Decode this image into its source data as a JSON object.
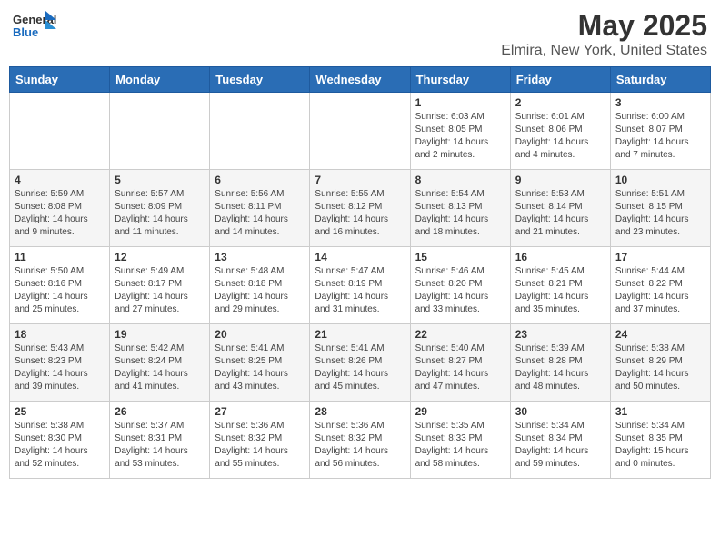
{
  "header": {
    "logo_general": "General",
    "logo_blue": "Blue",
    "title": "May 2025",
    "subtitle": "Elmira, New York, United States"
  },
  "days_of_week": [
    "Sunday",
    "Monday",
    "Tuesday",
    "Wednesday",
    "Thursday",
    "Friday",
    "Saturday"
  ],
  "weeks": [
    [
      {
        "day": "",
        "info": ""
      },
      {
        "day": "",
        "info": ""
      },
      {
        "day": "",
        "info": ""
      },
      {
        "day": "",
        "info": ""
      },
      {
        "day": "1",
        "info": "Sunrise: 6:03 AM\nSunset: 8:05 PM\nDaylight: 14 hours\nand 2 minutes."
      },
      {
        "day": "2",
        "info": "Sunrise: 6:01 AM\nSunset: 8:06 PM\nDaylight: 14 hours\nand 4 minutes."
      },
      {
        "day": "3",
        "info": "Sunrise: 6:00 AM\nSunset: 8:07 PM\nDaylight: 14 hours\nand 7 minutes."
      }
    ],
    [
      {
        "day": "4",
        "info": "Sunrise: 5:59 AM\nSunset: 8:08 PM\nDaylight: 14 hours\nand 9 minutes."
      },
      {
        "day": "5",
        "info": "Sunrise: 5:57 AM\nSunset: 8:09 PM\nDaylight: 14 hours\nand 11 minutes."
      },
      {
        "day": "6",
        "info": "Sunrise: 5:56 AM\nSunset: 8:11 PM\nDaylight: 14 hours\nand 14 minutes."
      },
      {
        "day": "7",
        "info": "Sunrise: 5:55 AM\nSunset: 8:12 PM\nDaylight: 14 hours\nand 16 minutes."
      },
      {
        "day": "8",
        "info": "Sunrise: 5:54 AM\nSunset: 8:13 PM\nDaylight: 14 hours\nand 18 minutes."
      },
      {
        "day": "9",
        "info": "Sunrise: 5:53 AM\nSunset: 8:14 PM\nDaylight: 14 hours\nand 21 minutes."
      },
      {
        "day": "10",
        "info": "Sunrise: 5:51 AM\nSunset: 8:15 PM\nDaylight: 14 hours\nand 23 minutes."
      }
    ],
    [
      {
        "day": "11",
        "info": "Sunrise: 5:50 AM\nSunset: 8:16 PM\nDaylight: 14 hours\nand 25 minutes."
      },
      {
        "day": "12",
        "info": "Sunrise: 5:49 AM\nSunset: 8:17 PM\nDaylight: 14 hours\nand 27 minutes."
      },
      {
        "day": "13",
        "info": "Sunrise: 5:48 AM\nSunset: 8:18 PM\nDaylight: 14 hours\nand 29 minutes."
      },
      {
        "day": "14",
        "info": "Sunrise: 5:47 AM\nSunset: 8:19 PM\nDaylight: 14 hours\nand 31 minutes."
      },
      {
        "day": "15",
        "info": "Sunrise: 5:46 AM\nSunset: 8:20 PM\nDaylight: 14 hours\nand 33 minutes."
      },
      {
        "day": "16",
        "info": "Sunrise: 5:45 AM\nSunset: 8:21 PM\nDaylight: 14 hours\nand 35 minutes."
      },
      {
        "day": "17",
        "info": "Sunrise: 5:44 AM\nSunset: 8:22 PM\nDaylight: 14 hours\nand 37 minutes."
      }
    ],
    [
      {
        "day": "18",
        "info": "Sunrise: 5:43 AM\nSunset: 8:23 PM\nDaylight: 14 hours\nand 39 minutes."
      },
      {
        "day": "19",
        "info": "Sunrise: 5:42 AM\nSunset: 8:24 PM\nDaylight: 14 hours\nand 41 minutes."
      },
      {
        "day": "20",
        "info": "Sunrise: 5:41 AM\nSunset: 8:25 PM\nDaylight: 14 hours\nand 43 minutes."
      },
      {
        "day": "21",
        "info": "Sunrise: 5:41 AM\nSunset: 8:26 PM\nDaylight: 14 hours\nand 45 minutes."
      },
      {
        "day": "22",
        "info": "Sunrise: 5:40 AM\nSunset: 8:27 PM\nDaylight: 14 hours\nand 47 minutes."
      },
      {
        "day": "23",
        "info": "Sunrise: 5:39 AM\nSunset: 8:28 PM\nDaylight: 14 hours\nand 48 minutes."
      },
      {
        "day": "24",
        "info": "Sunrise: 5:38 AM\nSunset: 8:29 PM\nDaylight: 14 hours\nand 50 minutes."
      }
    ],
    [
      {
        "day": "25",
        "info": "Sunrise: 5:38 AM\nSunset: 8:30 PM\nDaylight: 14 hours\nand 52 minutes."
      },
      {
        "day": "26",
        "info": "Sunrise: 5:37 AM\nSunset: 8:31 PM\nDaylight: 14 hours\nand 53 minutes."
      },
      {
        "day": "27",
        "info": "Sunrise: 5:36 AM\nSunset: 8:32 PM\nDaylight: 14 hours\nand 55 minutes."
      },
      {
        "day": "28",
        "info": "Sunrise: 5:36 AM\nSunset: 8:32 PM\nDaylight: 14 hours\nand 56 minutes."
      },
      {
        "day": "29",
        "info": "Sunrise: 5:35 AM\nSunset: 8:33 PM\nDaylight: 14 hours\nand 58 minutes."
      },
      {
        "day": "30",
        "info": "Sunrise: 5:34 AM\nSunset: 8:34 PM\nDaylight: 14 hours\nand 59 minutes."
      },
      {
        "day": "31",
        "info": "Sunrise: 5:34 AM\nSunset: 8:35 PM\nDaylight: 15 hours\nand 0 minutes."
      }
    ]
  ]
}
